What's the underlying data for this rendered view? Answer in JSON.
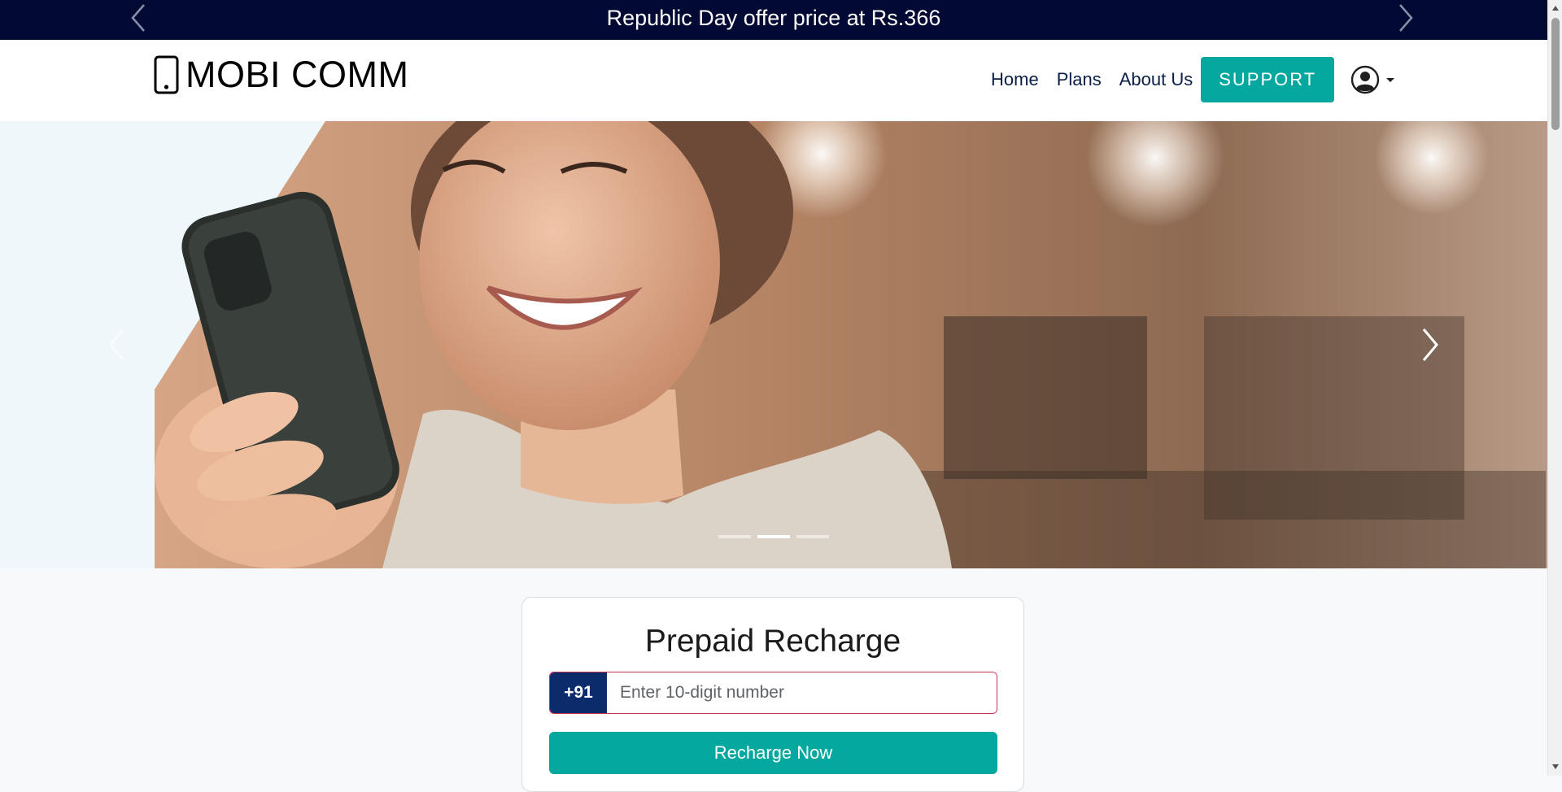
{
  "announcement": {
    "text": "Republic Day offer price at Rs.366"
  },
  "header": {
    "brand": "MOBI COMM",
    "nav": [
      "Home",
      "Plans",
      "About Us"
    ],
    "support_label": "SUPPORT"
  },
  "hero": {
    "slide_count": 3,
    "active_slide": 2
  },
  "recharge": {
    "title": "Prepaid Recharge",
    "country_code": "+91",
    "placeholder": "Enter 10-digit number",
    "button_label": "Recharge Now"
  },
  "colors": {
    "announcement_bg": "#020a34",
    "accent": "#04a89f",
    "country_code_bg": "#0b2b6b",
    "input_border": "#c9304f"
  }
}
